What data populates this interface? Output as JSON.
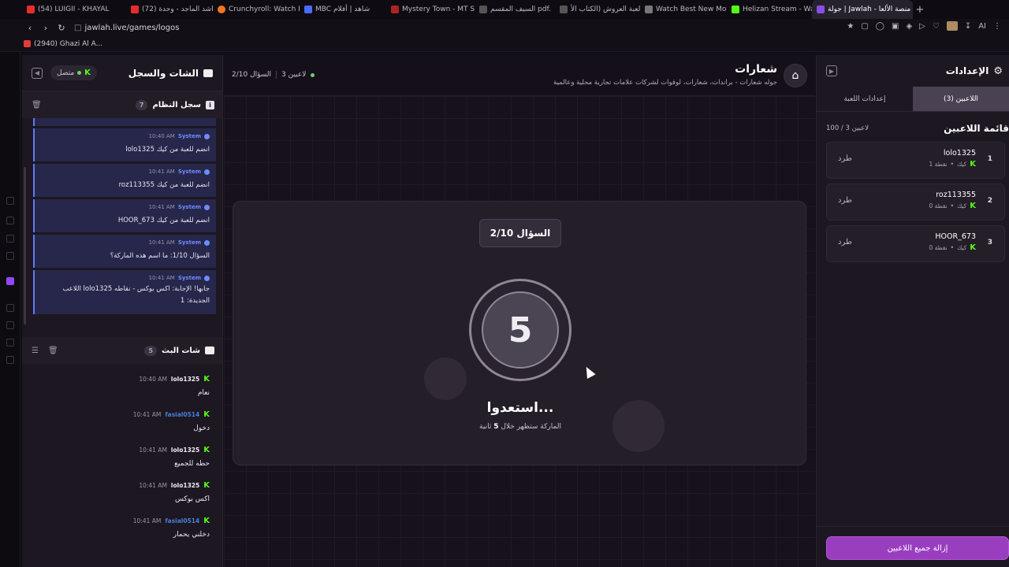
{
  "browser": {
    "tabs": [
      {
        "label": "(54) LUIGII - KHAYAL",
        "color": "#e62d2d"
      },
      {
        "label": "(72) راشد الماجد - وحدة",
        "color": "#e62d2d"
      },
      {
        "label": "Crunchyroll: Watch P",
        "color": "#f47521"
      },
      {
        "label": "MBC شاهد | أفلام",
        "color": "#4a6cf7"
      },
      {
        "label": "Mystery Town - MT S",
        "color": "#b02222"
      },
      {
        "label": "السيف المقسم pdf.",
        "color": "#555"
      },
      {
        "label": "لعبة العروش (الكتاب الأ",
        "color": "#555"
      },
      {
        "label": "Watch Best New Mov",
        "color": "#777"
      },
      {
        "label": "Helizan Stream - Wa",
        "color": "#53fc18"
      },
      {
        "label": "جولة | Jawlah - منصة الألعا",
        "color": "#8a4ee0"
      }
    ],
    "url": "jawlah.live/games/logos",
    "bookmark": "(2940) Ghazi Al A..."
  },
  "chat": {
    "title": "الشات والسجل",
    "status": "متصل",
    "system_log": {
      "title": "سجل النظام",
      "count": "7",
      "messages": [
        {
          "who": "System",
          "time": "10:40 AM",
          "text": "lolo1325 انضم للعبة من كيك"
        },
        {
          "who": "System",
          "time": "10:41 AM",
          "text": "roz113355 انضم للعبة من كيك"
        },
        {
          "who": "System",
          "time": "10:41 AM",
          "text": "HOOR_673 انضم للعبة من كيك"
        },
        {
          "who": "System",
          "time": "10:41 AM",
          "text": "السؤال 1/10: ما اسم هذه الماركة؟"
        },
        {
          "who": "System",
          "time": "10:41 AM",
          "text": "اللاعب lolo1325 جابها! الإجابة: اكس بوكس - نقاطه الجديدة: 1"
        }
      ]
    },
    "live_chat": {
      "title": "شات البث",
      "count": "5",
      "messages": [
        {
          "user": "lolo1325",
          "time": "10:40 AM",
          "text": "نعام",
          "blue": false
        },
        {
          "user": "fasial0514",
          "time": "10:41 AM",
          "text": "دخول",
          "blue": true
        },
        {
          "user": "lolo1325",
          "time": "10:41 AM",
          "text": "حطه للجميع",
          "blue": false
        },
        {
          "user": "lolo1325",
          "time": "10:41 AM",
          "text": "اكس بوكس",
          "blue": false
        },
        {
          "user": "fasial0514",
          "time": "10:41 AM",
          "text": "دخلني يحمار",
          "blue": true
        }
      ]
    }
  },
  "game": {
    "title": "شعارات",
    "subtitle": "جوله شعارات - براندات، شعارات، لوقوات لشركات علامات تجارية محلية وعالمية",
    "players_stat": "3 لاعبين",
    "question_stat": "السؤال 2/10",
    "question_badge": "السؤال 2/10",
    "countdown": "5",
    "ready_text": "استعدوا...",
    "ready_sub_before": "الماركة ستظهر خلال",
    "ready_sub_num": "5",
    "ready_sub_after": "ثانية"
  },
  "settings": {
    "title": "الإعدادات",
    "tabs": [
      "اللاعبين (3)",
      "إعدادات اللعبة"
    ],
    "players_title": "قائمة اللاعبين",
    "players_count": "100 / 3 لاعبين",
    "kick_label": "طرد",
    "players": [
      {
        "rank": "1",
        "name": "lolo1325",
        "platform": "كيك",
        "points": "1 نقطة"
      },
      {
        "rank": "2",
        "name": "roz113355",
        "platform": "كيك",
        "points": "0 نقطة"
      },
      {
        "rank": "3",
        "name": "HOOR_673",
        "platform": "كيك",
        "points": "0 نقطة"
      }
    ],
    "remove_all": "إزالة جميع اللاعبين"
  }
}
